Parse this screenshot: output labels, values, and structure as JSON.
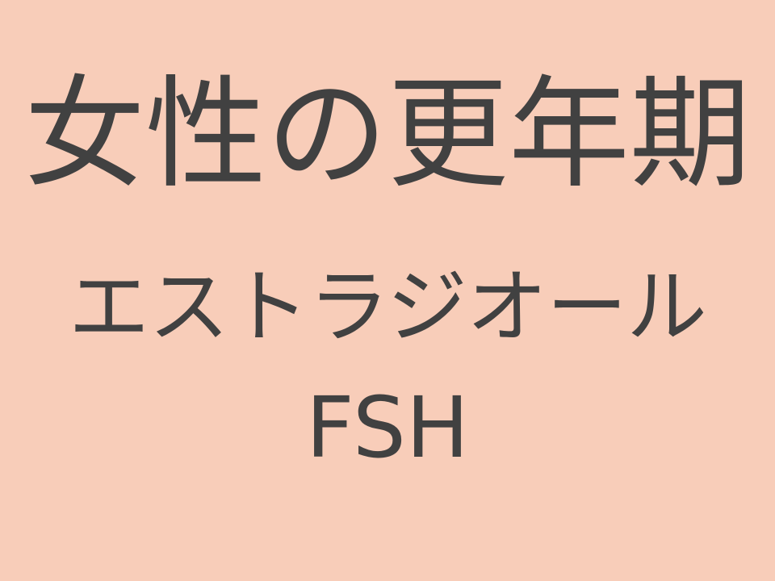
{
  "slide": {
    "title": "女性の更年期",
    "line2": "エストラジオール",
    "line3": "FSH",
    "colors": {
      "background": "#f8cdb9",
      "text": "#414141"
    }
  }
}
